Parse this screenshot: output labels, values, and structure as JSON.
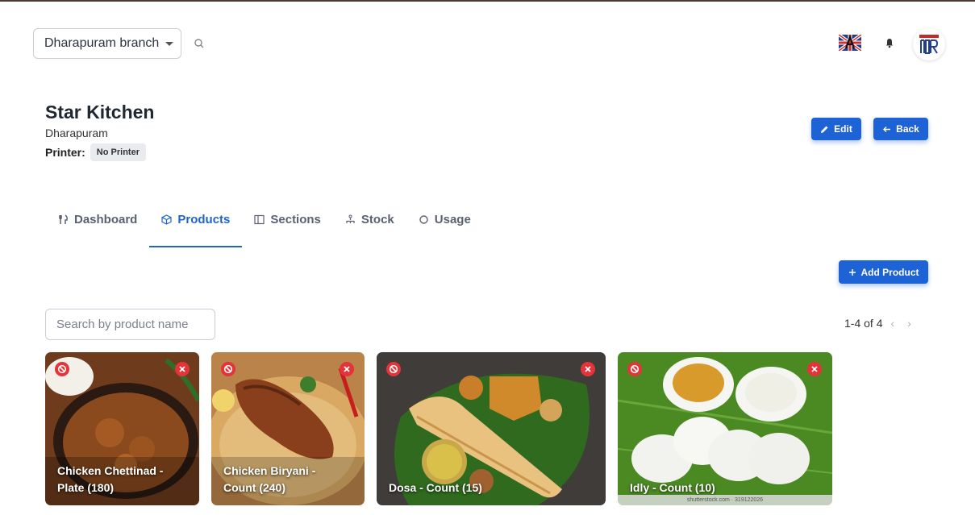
{
  "header": {
    "branch_selector": "Dharapuram branch",
    "icons": [
      "search-icon",
      "flag-icon",
      "bell-icon",
      "avatar-logo"
    ]
  },
  "kitchen": {
    "name": "Star Kitchen",
    "location": "Dharapuram",
    "printer_label": "Printer:",
    "printer_value": "No Printer"
  },
  "actions": {
    "edit_label": "Edit",
    "back_label": "Back",
    "add_product_label": "Add Product"
  },
  "tabs": [
    {
      "label": "Dashboard",
      "icon": "utensils-icon"
    },
    {
      "label": "Products",
      "icon": "box-icon",
      "active": true
    },
    {
      "label": "Sections",
      "icon": "columns-icon"
    },
    {
      "label": "Stock",
      "icon": "network-icon"
    },
    {
      "label": "Usage",
      "icon": "circle-icon"
    }
  ],
  "products_toolbar": {
    "search_placeholder": "Search by product name",
    "pagination": "1-4 of 4"
  },
  "products": [
    {
      "name_line1": "Chicken Chettinad -",
      "name_line2": "Plate (180)"
    },
    {
      "name_line1": "Chicken Biryani -",
      "name_line2": "Count (240)"
    },
    {
      "name_line1": "Dosa - Count (15)",
      "name_line2": ""
    },
    {
      "name_line1": "Idly - Count (10)",
      "name_line2": "",
      "watermark": "shutterstock.com · 319122026"
    }
  ],
  "colors": {
    "accent": "#1e63d6",
    "danger_badge": "#e5333a"
  }
}
